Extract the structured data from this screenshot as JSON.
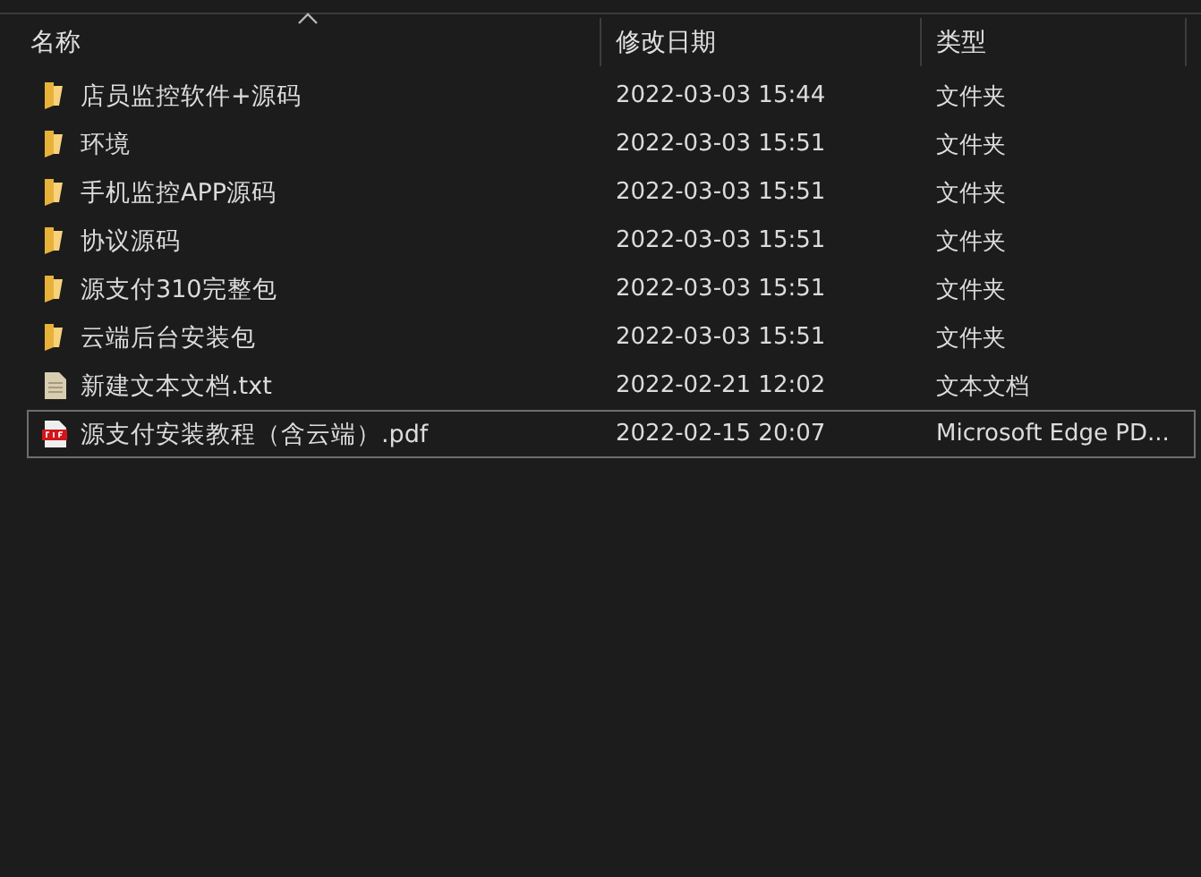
{
  "columns": [
    {
      "label": "名称",
      "sorted": true
    },
    {
      "label": "修改日期",
      "sorted": false
    },
    {
      "label": "类型",
      "sorted": false
    }
  ],
  "rows": [
    {
      "name": "店员监控软件+源码",
      "date": "2022-03-03 15:44",
      "type": "文件夹",
      "kind": "folder",
      "focused": false
    },
    {
      "name": "环境",
      "date": "2022-03-03 15:51",
      "type": "文件夹",
      "kind": "folder",
      "focused": false
    },
    {
      "name": "手机监控APP源码",
      "date": "2022-03-03 15:51",
      "type": "文件夹",
      "kind": "folder",
      "focused": false
    },
    {
      "name": "协议源码",
      "date": "2022-03-03 15:51",
      "type": "文件夹",
      "kind": "folder",
      "focused": false
    },
    {
      "name": "源支付310完整包",
      "date": "2022-03-03 15:51",
      "type": "文件夹",
      "kind": "folder",
      "focused": false
    },
    {
      "name": "云端后台安装包",
      "date": "2022-03-03 15:51",
      "type": "文件夹",
      "kind": "folder",
      "focused": false
    },
    {
      "name": "新建文本文档.txt",
      "date": "2022-02-21 12:02",
      "type": "文本文档",
      "kind": "text",
      "focused": false
    },
    {
      "name": "源支付安装教程（含云端）.pdf",
      "date": "2022-02-15 20:07",
      "type": "Microsoft Edge PD...",
      "kind": "pdf",
      "focused": true
    }
  ]
}
